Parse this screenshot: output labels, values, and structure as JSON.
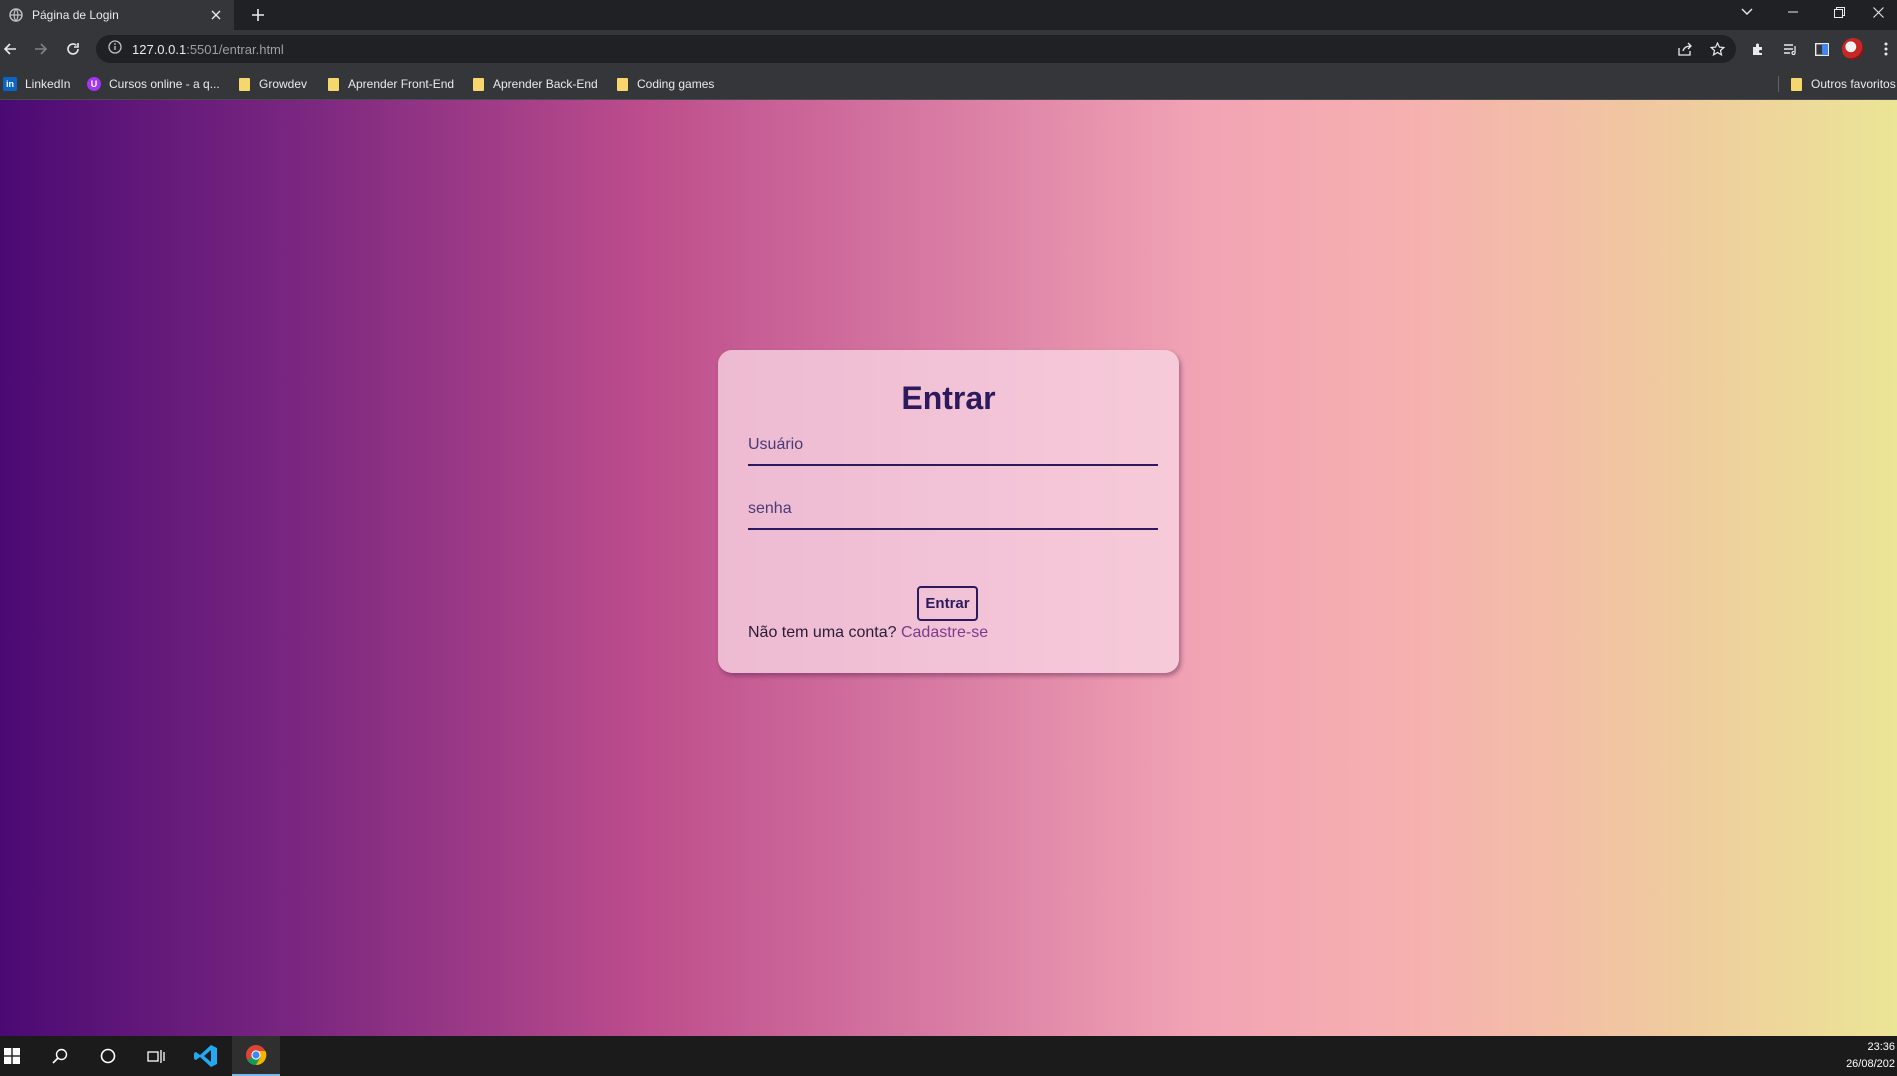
{
  "browser": {
    "tab_title": "Página de Login",
    "url_host": "127.0.0.1",
    "url_rest": ":5501/entrar.html"
  },
  "bookmarks": [
    {
      "label": "LinkedIn",
      "icon": "linkedin-icon"
    },
    {
      "label": "Cursos online - a q...",
      "icon": "udemy-icon"
    },
    {
      "label": "Growdev",
      "icon": "folder-icon"
    },
    {
      "label": "Aprender Front-End",
      "icon": "folder-icon"
    },
    {
      "label": "Aprender Back-End",
      "icon": "folder-icon"
    },
    {
      "label": "Coding games",
      "icon": "folder-icon"
    }
  ],
  "other_bookmarks": "Outros favoritos",
  "login": {
    "title": "Entrar",
    "username_placeholder": "Usuário",
    "password_placeholder": "senha",
    "submit_label": "Entrar",
    "no_account_text": "Não tem uma conta? ",
    "signup_link": "Cadastre-se"
  },
  "background_gradient": [
    "#4a0a73",
    "#bd4d8c",
    "#f6b0b0",
    "#ebe596"
  ],
  "accent_color": "#2d1a5e",
  "taskbar": {
    "time": "23:36",
    "date": "26/08/202"
  }
}
